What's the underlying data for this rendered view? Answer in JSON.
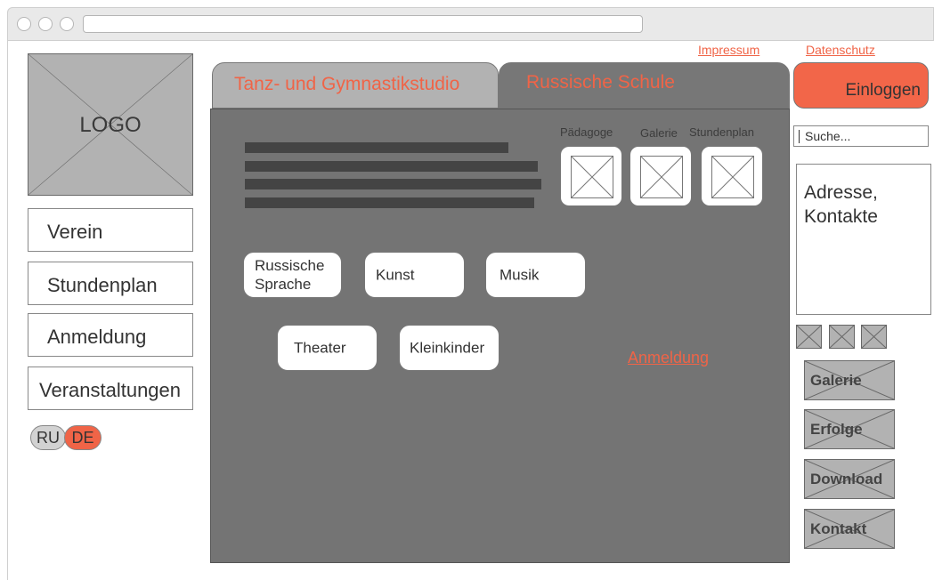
{
  "header": {
    "impressum": "Impressum",
    "datenschutz": "Datenschutz"
  },
  "logo": "LOGO",
  "nav": {
    "items": [
      {
        "label": "Verein"
      },
      {
        "label": "Stundenplan"
      },
      {
        "label": "Anmeldung"
      },
      {
        "label": "Veranstaltungen"
      }
    ]
  },
  "languages": {
    "ru": "RU",
    "de": "DE",
    "active": "DE"
  },
  "tabs": [
    {
      "label": "Tanz- und Gymnastikstudio"
    },
    {
      "label": "Russische Schule"
    }
  ],
  "thumbs": [
    {
      "label": "Pädagoge"
    },
    {
      "label": "Galerie"
    },
    {
      "label": "Stundenplan"
    }
  ],
  "courses": [
    {
      "label": "Russische Sprache"
    },
    {
      "label": "Kunst"
    },
    {
      "label": "Musik"
    },
    {
      "label": "Theater"
    },
    {
      "label": "Kleinkinder"
    }
  ],
  "main_link": "Anmeldung",
  "right": {
    "login": "Einloggen",
    "search_placeholder": "Suche...",
    "address": "Adresse, Kontakte",
    "side_links": [
      {
        "label": "Galerie"
      },
      {
        "label": "Erfolge"
      },
      {
        "label": "Download"
      },
      {
        "label": "Kontakt"
      }
    ]
  },
  "colors": {
    "accent": "#f06447",
    "panel": "#747474",
    "placeholder": "#b2b2b2"
  }
}
